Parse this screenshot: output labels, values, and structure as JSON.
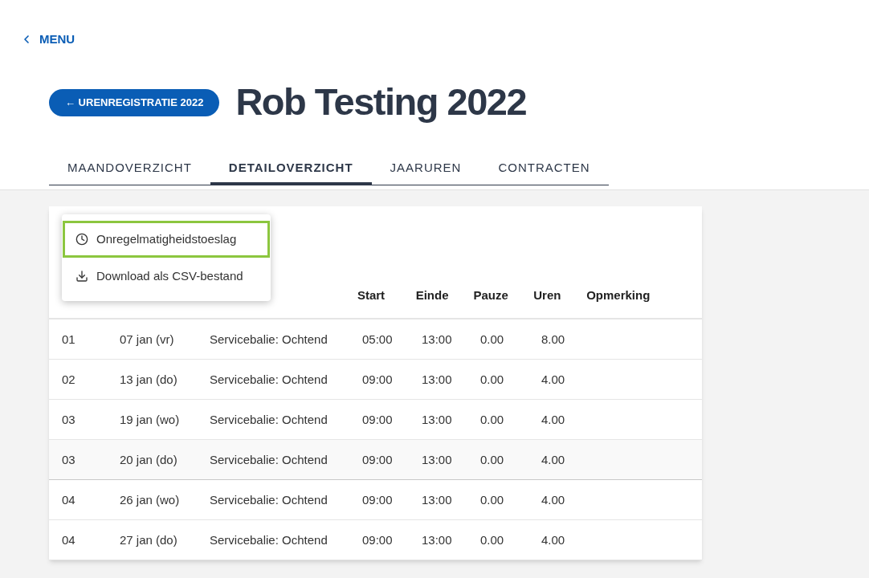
{
  "back_link": {
    "label": "MENU"
  },
  "header": {
    "back_button": "← URENREGISTRATIE 2022",
    "title": "Rob Testing 2022"
  },
  "tabs": [
    {
      "label": "MAANDOVERZICHT",
      "selected": false
    },
    {
      "label": "DETAILOVERZICHT",
      "selected": true
    },
    {
      "label": "JAARUREN",
      "selected": false
    },
    {
      "label": "CONTRACTEN",
      "selected": false
    }
  ],
  "table": {
    "columns": [
      "",
      "",
      "",
      "Start",
      "Einde",
      "Pauze",
      "Uren",
      "Opmerking"
    ],
    "rows": [
      {
        "cells": [
          "01",
          "07 jan (vr)",
          "Servicebalie: Ochtend",
          "05:00",
          "13:00",
          "0.00",
          "8.00"
        ],
        "highlighted": false
      },
      {
        "cells": [
          "02",
          "13 jan (do)",
          "Servicebalie: Ochtend",
          "09:00",
          "13:00",
          "0.00",
          "4.00"
        ],
        "highlighted": false
      },
      {
        "cells": [
          "03",
          "19 jan (wo)",
          "Servicebalie: Ochtend",
          "09:00",
          "13:00",
          "0.00",
          "4.00"
        ],
        "highlighted": false
      },
      {
        "cells": [
          "03",
          "20 jan (do)",
          "Servicebalie: Ochtend",
          "09:00",
          "13:00",
          "0.00",
          "4.00"
        ],
        "highlighted": true
      },
      {
        "cells": [
          "04",
          "26 jan (wo)",
          "Servicebalie: Ochtend",
          "09:00",
          "13:00",
          "0.00",
          "4.00"
        ],
        "highlighted": false
      },
      {
        "cells": [
          "04",
          "27 jan (do)",
          "Servicebalie: Ochtend",
          "09:00",
          "13:00",
          "0.00",
          "4.00"
        ],
        "highlighted": false
      }
    ]
  },
  "menu": {
    "items": [
      {
        "label": "Onregelmatigheidstoeslag",
        "kind": "clock",
        "selected": true
      },
      {
        "label": "Download als CSV-bestand",
        "kind": "download",
        "selected": false
      }
    ]
  }
}
